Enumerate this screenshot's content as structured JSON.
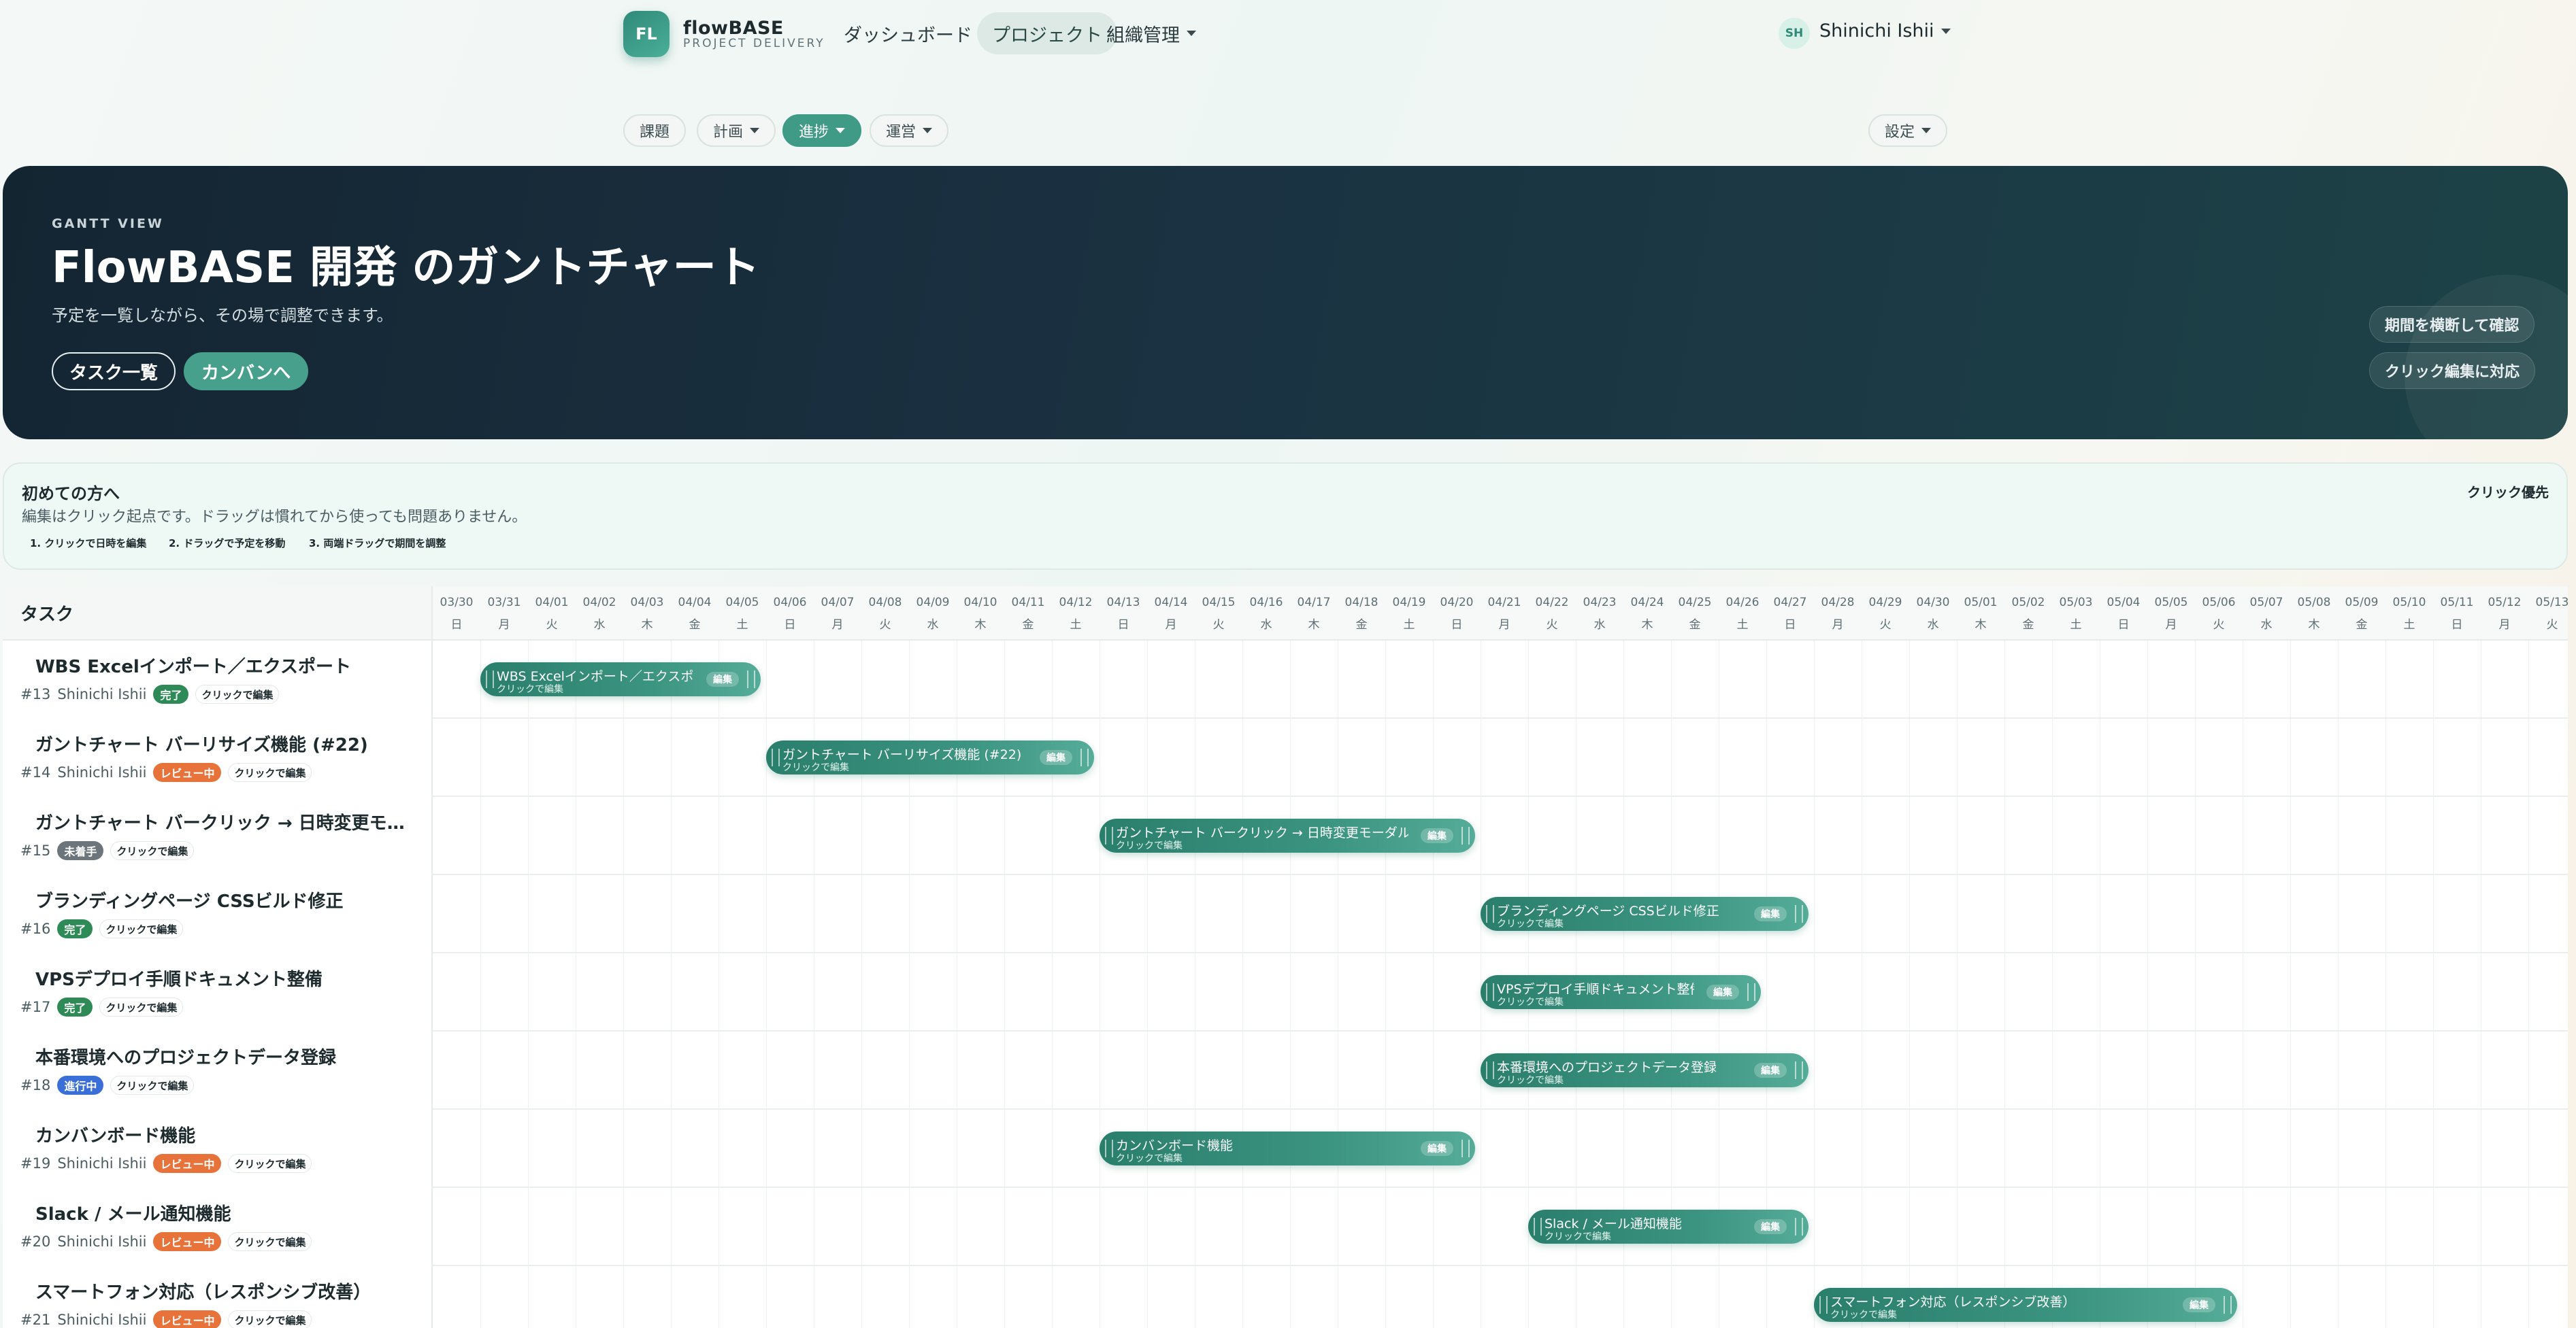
{
  "brand": {
    "logo": "FL",
    "name": "flowBASE",
    "sub": "PROJECT DELIVERY"
  },
  "nav": {
    "dashboard": "ダッシュボード",
    "project": "プロジェクト",
    "org": "組織管理"
  },
  "user": {
    "initials": "SH",
    "name": "Shinichi Ishii"
  },
  "subnav": {
    "issues": "課題",
    "plan": "計画",
    "progress": "進捗",
    "ops": "運営",
    "settings": "設定"
  },
  "hero": {
    "eyebrow": "GANTT VIEW",
    "title": "FlowBASE 開発 のガントチャート",
    "desc": "予定を一覧しながら、その場で調整できます。",
    "btn_tasks": "タスク一覧",
    "btn_kanban": "カンバンへ",
    "chip1": "期間を横断して確認",
    "chip2": "クリック編集に対応"
  },
  "guide": {
    "title": "初めての方へ",
    "desc": "編集はクリック起点です。ドラッグは慣れてから使っても問題ありません。",
    "step1": "1. クリックで日時を編集",
    "step2": "2. ドラッグで予定を移動",
    "step3": "3. 両端ドラッグで期間を調整",
    "right": "クリック優先"
  },
  "gantt": {
    "task_header": "タスク",
    "edit_hint": "クリックで編集",
    "bar_sub": "クリックで編集",
    "bar_edit": "編集",
    "dates": [
      {
        "d": "03/30",
        "w": "日"
      },
      {
        "d": "03/31",
        "w": "月"
      },
      {
        "d": "04/01",
        "w": "火"
      },
      {
        "d": "04/02",
        "w": "水"
      },
      {
        "d": "04/03",
        "w": "木"
      },
      {
        "d": "04/04",
        "w": "金"
      },
      {
        "d": "04/05",
        "w": "土"
      },
      {
        "d": "04/06",
        "w": "日"
      },
      {
        "d": "04/07",
        "w": "月"
      },
      {
        "d": "04/08",
        "w": "火"
      },
      {
        "d": "04/09",
        "w": "水"
      },
      {
        "d": "04/10",
        "w": "木"
      },
      {
        "d": "04/11",
        "w": "金"
      },
      {
        "d": "04/12",
        "w": "土"
      },
      {
        "d": "04/13",
        "w": "日"
      },
      {
        "d": "04/14",
        "w": "月"
      },
      {
        "d": "04/15",
        "w": "火"
      },
      {
        "d": "04/16",
        "w": "水"
      },
      {
        "d": "04/17",
        "w": "木"
      },
      {
        "d": "04/18",
        "w": "金"
      },
      {
        "d": "04/19",
        "w": "土"
      },
      {
        "d": "04/20",
        "w": "日"
      },
      {
        "d": "04/21",
        "w": "月"
      },
      {
        "d": "04/22",
        "w": "火"
      },
      {
        "d": "04/23",
        "w": "水"
      },
      {
        "d": "04/24",
        "w": "木"
      },
      {
        "d": "04/25",
        "w": "金"
      },
      {
        "d": "04/26",
        "w": "土"
      },
      {
        "d": "04/27",
        "w": "日"
      },
      {
        "d": "04/28",
        "w": "月"
      },
      {
        "d": "04/29",
        "w": "火"
      },
      {
        "d": "04/30",
        "w": "水"
      },
      {
        "d": "05/01",
        "w": "木"
      },
      {
        "d": "05/02",
        "w": "金"
      },
      {
        "d": "05/03",
        "w": "土"
      },
      {
        "d": "05/04",
        "w": "日"
      },
      {
        "d": "05/05",
        "w": "月"
      },
      {
        "d": "05/06",
        "w": "火"
      },
      {
        "d": "05/07",
        "w": "水"
      },
      {
        "d": "05/08",
        "w": "木"
      },
      {
        "d": "05/09",
        "w": "金"
      },
      {
        "d": "05/10",
        "w": "土"
      },
      {
        "d": "05/11",
        "w": "日"
      },
      {
        "d": "05/12",
        "w": "月"
      },
      {
        "d": "05/13",
        "w": "火"
      }
    ],
    "tasks": [
      {
        "name": "WBS Excelインポート／エクスポート",
        "id": "#13",
        "assignee": "Shinichi Ishii",
        "status": "完了",
        "status_type": "done",
        "bar_title": "WBS Excelインポート／エクスポート",
        "start": "03/31",
        "end": "04/05"
      },
      {
        "name": "ガントチャート バーリサイズ機能 (#22)",
        "id": "#14",
        "assignee": "Shinichi Ishii",
        "status": "レビュー中",
        "status_type": "review",
        "bar_title": "ガントチャート バーリサイズ機能 (#22)",
        "start": "04/06",
        "end": "04/12"
      },
      {
        "name": "ガントチャート バークリック → 日時変更モーダ…",
        "id": "#15",
        "assignee": "",
        "status": "未着手",
        "status_type": "todo",
        "bar_title": "ガントチャート バークリック → 日時変更モーダル (#",
        "start": "04/13",
        "end": "04/20"
      },
      {
        "name": "ブランディングページ CSSビルド修正",
        "id": "#16",
        "assignee": "",
        "status": "完了",
        "status_type": "done",
        "bar_title": "ブランディングページ CSSビルド修正",
        "start": "04/21",
        "end": "04/27"
      },
      {
        "name": "VPSデプロイ手順ドキュメント整備",
        "id": "#17",
        "assignee": "",
        "status": "完了",
        "status_type": "done",
        "bar_title": "VPSデプロイ手順ドキュメント整備",
        "start": "04/21",
        "end": "04/26"
      },
      {
        "name": "本番環境へのプロジェクトデータ登録",
        "id": "#18",
        "assignee": "",
        "status": "進行中",
        "status_type": "doing",
        "bar_title": "本番環境へのプロジェクトデータ登録",
        "start": "04/21",
        "end": "04/27"
      },
      {
        "name": "カンバンボード機能",
        "id": "#19",
        "assignee": "Shinichi Ishii",
        "status": "レビュー中",
        "status_type": "review",
        "bar_title": "カンバンボード機能",
        "start": "04/13",
        "end": "04/20"
      },
      {
        "name": "Slack / メール通知機能",
        "id": "#20",
        "assignee": "Shinichi Ishii",
        "status": "レビュー中",
        "status_type": "review",
        "bar_title": "Slack / メール通知機能",
        "start": "04/22",
        "end": "04/27"
      },
      {
        "name": "スマートフォン対応（レスポンシブ改善）",
        "id": "#21",
        "assignee": "Shinichi Ishii",
        "status": "レビュー中",
        "status_type": "review",
        "bar_title": "スマートフォン対応（レスポンシブ改善）",
        "start": "04/28",
        "end": "05/06"
      }
    ]
  }
}
